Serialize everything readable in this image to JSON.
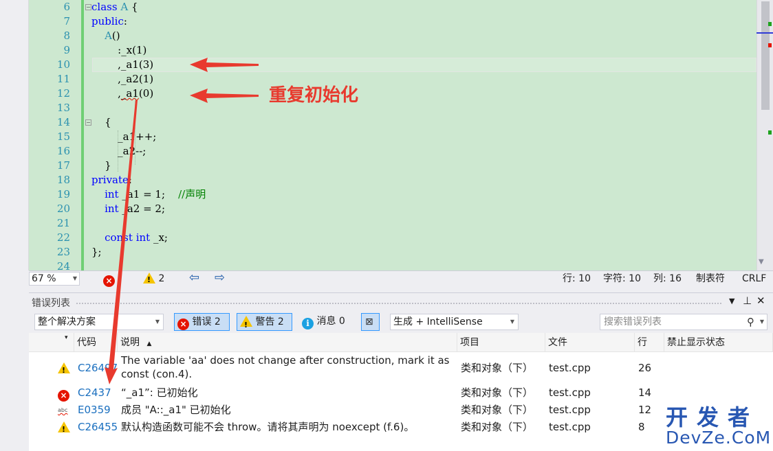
{
  "editor": {
    "lines": [
      {
        "num": "6",
        "text": "class A {"
      },
      {
        "num": "7",
        "text": "public:"
      },
      {
        "num": "8",
        "text": "    A()"
      },
      {
        "num": "9",
        "text": "        :_x(1)"
      },
      {
        "num": "10",
        "text": "        ,_a1(3)"
      },
      {
        "num": "11",
        "text": "        ,_a2(1)"
      },
      {
        "num": "12",
        "text": "        ,_a1(0)"
      },
      {
        "num": "13",
        "text": ""
      },
      {
        "num": "14",
        "text": "    {"
      },
      {
        "num": "15",
        "text": "        _a1++;"
      },
      {
        "num": "16",
        "text": "        _a2--;"
      },
      {
        "num": "17",
        "text": "    }"
      },
      {
        "num": "18",
        "text": "private:"
      },
      {
        "num": "19",
        "text": "    int _a1 = 1;    //声明"
      },
      {
        "num": "20",
        "text": "    int _a2 = 2;"
      },
      {
        "num": "21",
        "text": ""
      },
      {
        "num": "22",
        "text": "    const int _x;"
      },
      {
        "num": "23",
        "text": "};"
      },
      {
        "num": "24",
        "text": ""
      }
    ],
    "annotation": "重复初始化",
    "colors": {
      "background": "#cde8d0",
      "keyword": "#0000ff",
      "comment": "#008000",
      "line_number": "#2b91af",
      "arrow": "#e83a2e"
    }
  },
  "status": {
    "zoom": "67 %",
    "error_count": "2",
    "warning_count": "2",
    "line": "行: 10",
    "char": "字符: 10",
    "col": "列: 16",
    "tab_mode": "制表符",
    "line_ending": "CRLF"
  },
  "error_list": {
    "title": "错误列表",
    "scope": "整个解决方案",
    "errors_btn": "错误 2",
    "warnings_btn": "警告 2",
    "messages_btn": "消息 0",
    "build_filter": "生成 + IntelliSense",
    "search_placeholder": "搜索错误列表",
    "columns": [
      "代码",
      "说明",
      "项目",
      "文件",
      "行",
      "禁止显示状态"
    ],
    "rows": [
      {
        "icon": "warning-icon",
        "code": "C26497",
        "desc1": "The variable 'aa' does not change after construction, mark it as",
        "desc2": "const (con.4).",
        "project": "类和对象（下）",
        "file": "test.cpp",
        "line": "26"
      },
      {
        "icon": "error-icon",
        "code": "C2437",
        "desc1": "“_a1”: 已初始化",
        "desc2": "",
        "project": "类和对象（下）",
        "file": "test.cpp",
        "line": "14"
      },
      {
        "icon": "intellisense-icon",
        "code": "E0359",
        "desc1": "成员 \"A::_a1\" 已初始化",
        "desc2": "",
        "project": "类和对象（下）",
        "file": "test.cpp",
        "line": "12"
      },
      {
        "icon": "warning-icon",
        "code": "C26455",
        "desc1": "默认构造函数可能不会 throw。请将其声明为 noexcept (f.6)。",
        "desc2": "",
        "project": "类和对象（下）",
        "file": "test.cpp",
        "line": "8"
      }
    ]
  },
  "watermark": {
    "line1": "开发者",
    "line2": "DevZe.CoM"
  }
}
